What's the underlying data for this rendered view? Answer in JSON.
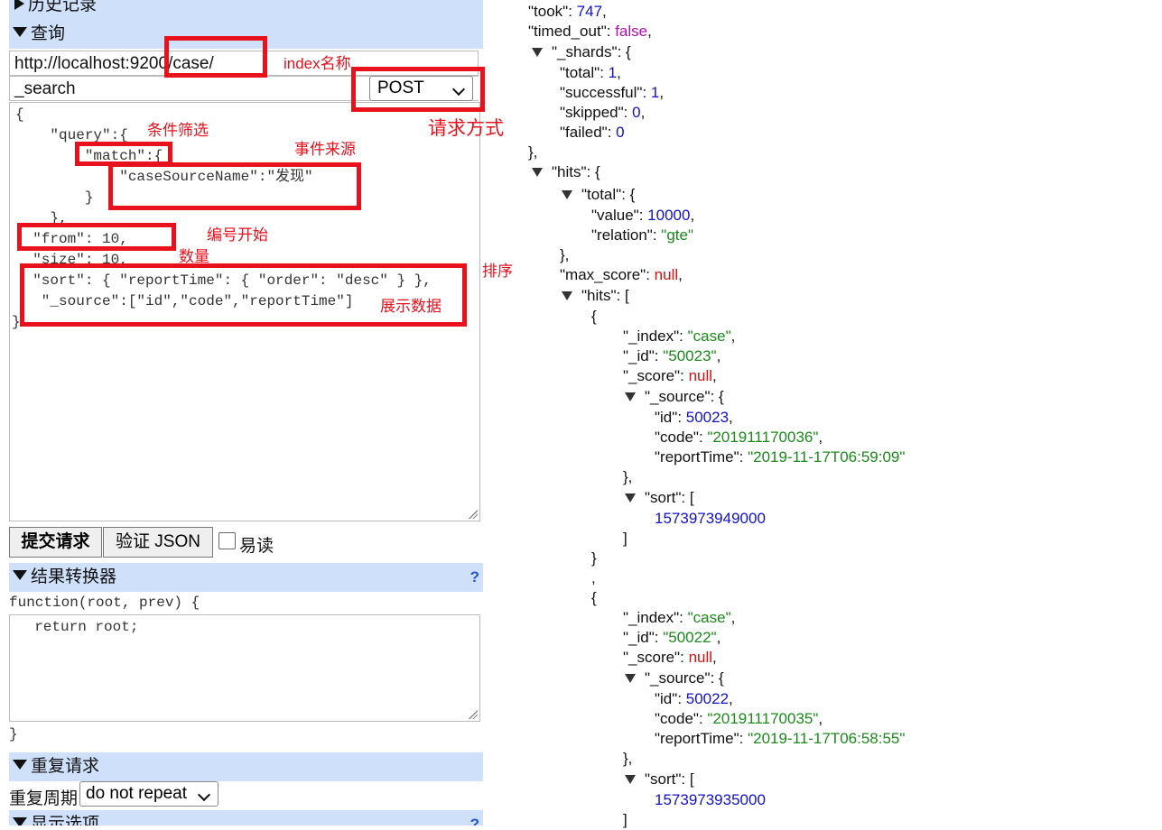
{
  "sections": {
    "history": "历史记录",
    "query": "查询",
    "transformer": "结果转换器",
    "repeat": "重复请求",
    "display": "显示选项",
    "help": "?"
  },
  "request": {
    "url": "http://localhost:9200/case/",
    "path": "_search",
    "method": "POST",
    "body_lines": [
      "{",
      "    \"query\":{",
      "        \"match\":{",
      "            \"caseSourceName\":\"发现\"",
      "        }",
      "    },",
      "  \"from\": 10,",
      "  \"size\": 10,",
      "  \"sort\": { \"reportTime\": { \"order\": \"desc\" } },",
      "   \"_source\":[\"id\",\"code\",\"reportTime\"]",
      "}"
    ]
  },
  "annotations": {
    "index_name": "index名称",
    "method": "请求方式",
    "filter": "条件筛选",
    "event_source": "事件来源",
    "from": "编号开始",
    "size": "数量",
    "sort": "排序",
    "display": "展示数据"
  },
  "buttons": {
    "submit": "提交请求",
    "validate": "验证 JSON",
    "readable": "易读"
  },
  "transformer": {
    "signature": "function(root, prev) {",
    "body": "  return root;",
    "close": "}"
  },
  "repeat": {
    "label": "重复周期",
    "value": "do not repeat"
  },
  "response": {
    "took_key": "\"took\"",
    "took_val": "747",
    "timed_out_key": "\"timed_out\"",
    "timed_out_val": "false",
    "shards_key": "\"_shards\"",
    "total_key": "\"total\"",
    "total_val": "1",
    "successful_key": "\"successful\"",
    "successful_val": "1",
    "skipped_key": "\"skipped\"",
    "skipped_val": "0",
    "failed_key": "\"failed\"",
    "failed_val": "0",
    "hits_key": "\"hits\"",
    "hits_total_key": "\"total\"",
    "value_key": "\"value\"",
    "value_val": "10000",
    "relation_key": "\"relation\"",
    "relation_val": "\"gte\"",
    "max_score_key": "\"max_score\"",
    "max_score_val": "null",
    "hits_arr_key": "\"hits\"",
    "hit1": {
      "index": "\"case\"",
      "id": "\"50023\"",
      "score": "null",
      "src_id": "50023",
      "code": "\"201911170036\"",
      "reportTime": "\"2019-11-17T06:59:09\"",
      "sort": "1573973949000"
    },
    "hit2": {
      "index": "\"case\"",
      "id": "\"50022\"",
      "score": "null",
      "src_id": "50022",
      "code": "\"201911170035\"",
      "reportTime": "\"2019-11-17T06:58:55\"",
      "sort": "1573973935000"
    },
    "k_index": "\"_index\"",
    "k_id": "\"_id\"",
    "k_score": "\"_score\"",
    "k_source": "\"_source\"",
    "k_srcid": "\"id\"",
    "k_code": "\"code\"",
    "k_reportTime": "\"reportTime\"",
    "k_sort": "\"sort\""
  }
}
